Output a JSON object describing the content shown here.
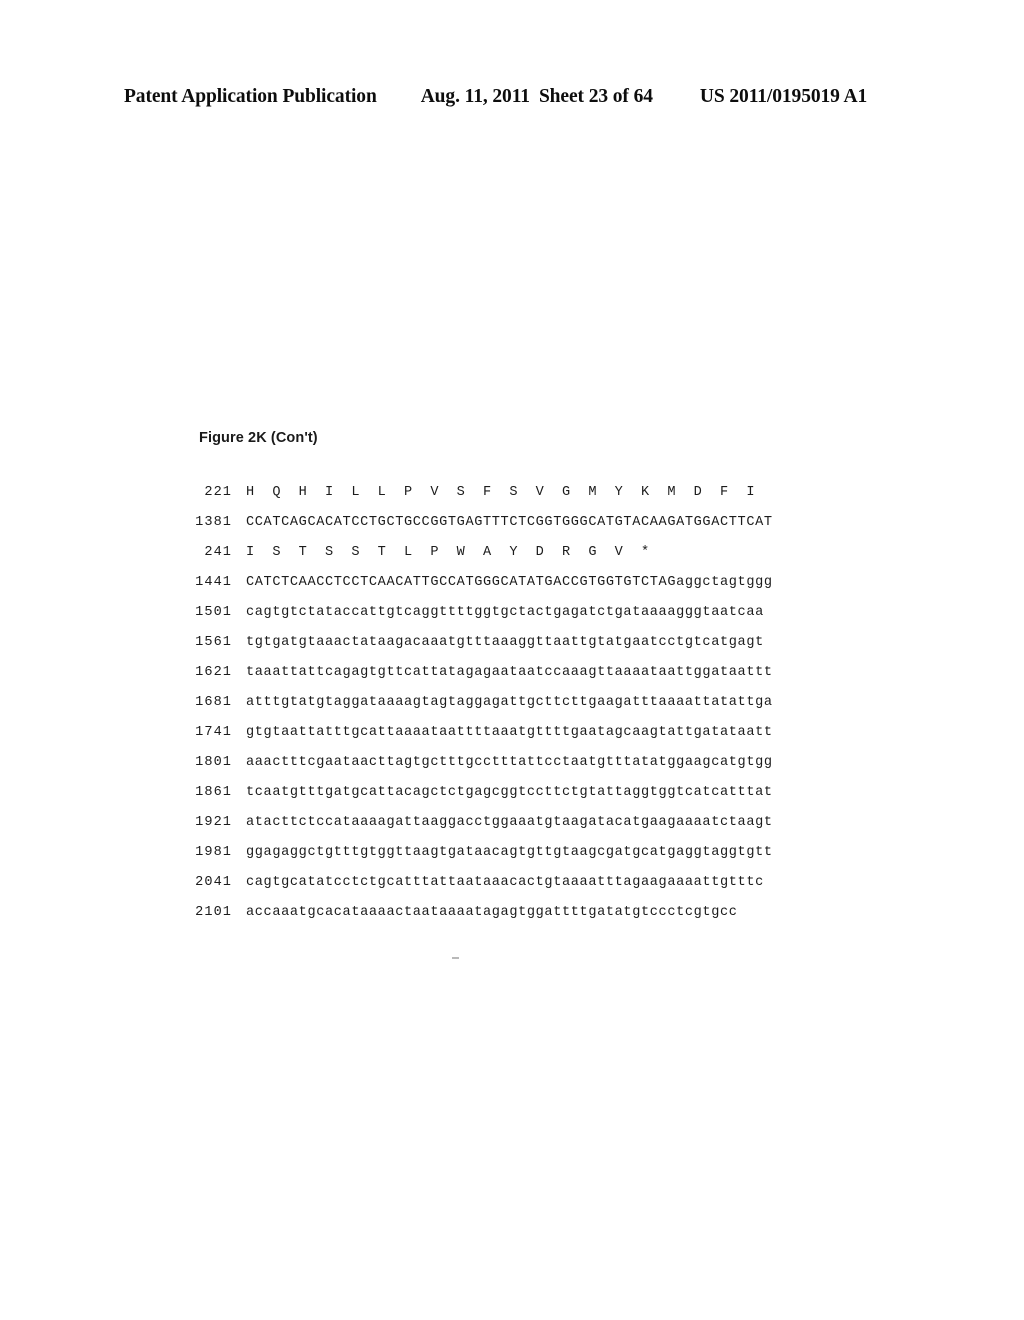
{
  "header": {
    "publication_type": "Patent Application Publication",
    "date": "Aug. 11, 2011",
    "sheet": "Sheet 23 of 64",
    "publication_number": "US 2011/0195019 A1"
  },
  "figure": {
    "caption": "Figure 2K (Con't)"
  },
  "sequence": {
    "rows": [
      {
        "number": "221",
        "type": "protein",
        "text": "H  Q  H  I  L  L  P  V  S  F  S  V  G  M  Y  K  M  D  F  I"
      },
      {
        "number": "1381",
        "type": "dna",
        "text": "CCATCAGCACATCCTGCTGCCGGTGAGTTTCTCGGTGGGCATGTACAAGATGGACTTCAT"
      },
      {
        "number": "241",
        "type": "protein",
        "text": "I  S  T  S  S  T  L  P  W  A  Y  D  R  G  V  *"
      },
      {
        "number": "1441",
        "type": "dna",
        "text": "CATCTCAACCTCCTCAACATTGCCATGGGCATATGACCGTGGTGTCTAGaggctagtggg"
      },
      {
        "number": "1501",
        "type": "dna",
        "text": "cagtgtctataccattgtcaggttttggtgctactgagatctgataaaagggtaatcaa"
      },
      {
        "number": "1561",
        "type": "dna",
        "text": "tgtgatgtaaactataagacaaatgtttaaaggttaattgtatgaatcctgtcatgagt"
      },
      {
        "number": "1621",
        "type": "dna",
        "text": "taaattattcagagtgttcattatagagaataatccaaagttaaaataattggataattt"
      },
      {
        "number": "1681",
        "type": "dna",
        "text": "atttgtatgtaggataaaagtagtaggagattgcttcttgaagatttaaaattatattga"
      },
      {
        "number": "1741",
        "type": "dna",
        "text": "gtgtaattatttgcattaaaataattttaaatgttttgaatagcaagtattgatataatt"
      },
      {
        "number": "1801",
        "type": "dna",
        "text": "aaactttcgaataacttagtgctttgcctttattcctaatgtttatatggaagcatgtgg"
      },
      {
        "number": "1861",
        "type": "dna",
        "text": "tcaatgtttgatgcattacagctctgagcggtccttctgtattaggtggtcatcatttat"
      },
      {
        "number": "1921",
        "type": "dna",
        "text": "atacttctccataaaagattaaggacctggaaatgtaagatacatgaagaaaatctaagt"
      },
      {
        "number": "1981",
        "type": "dna",
        "text": "ggagaggctgtttgtggttaagtgataacagtgttgtaagcgatgcatgaggtaggtgtt"
      },
      {
        "number": "2041",
        "type": "dna",
        "text": "cagtgcatatcctctgcatttattaataaacactgtaaaatttagaagaaaattgtttc"
      },
      {
        "number": "2101",
        "type": "dna",
        "text": "accaaatgcacataaaactaataaaatagagtggattttgatatgtccctcgtgcc"
      }
    ]
  }
}
